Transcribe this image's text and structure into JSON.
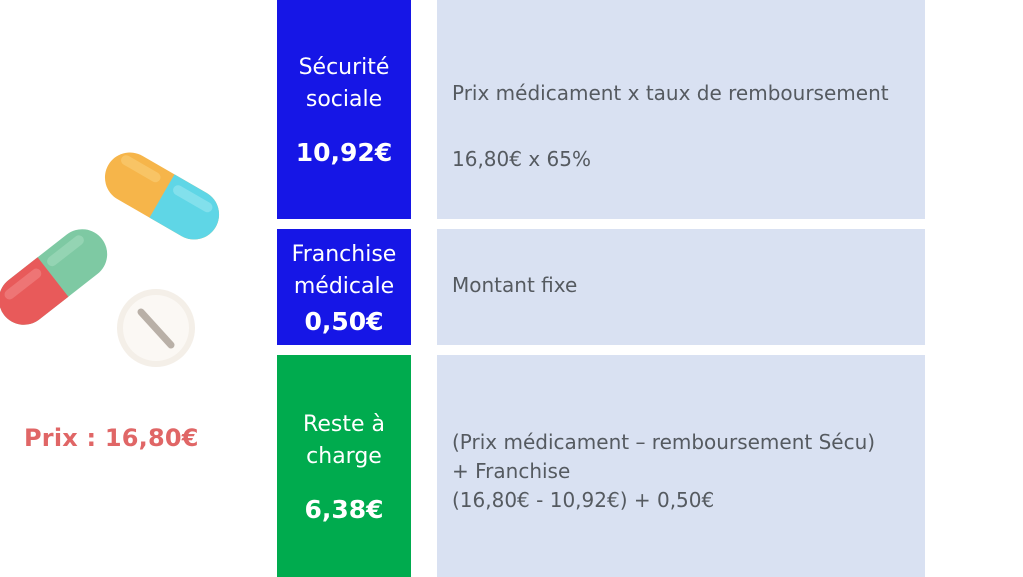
{
  "price_label": "Prix : 16,80€",
  "rows": [
    {
      "left_label_lines": [
        "Sécurité",
        "sociale"
      ],
      "left_amount": "10,92€",
      "right_lines": [
        "Prix médicament x taux de remboursement",
        "16,80€ x 65%"
      ]
    },
    {
      "left_label_lines": [
        "Franchise",
        "médicale"
      ],
      "left_amount": "0,50€",
      "right_lines": [
        "Montant fixe"
      ]
    },
    {
      "left_label_lines": [
        "Reste à",
        "charge"
      ],
      "left_amount": "6,38€",
      "right_lines": [
        "(Prix médicament – remboursement Sécu)",
        "+ Franchise",
        "(16,80€ - 10,92€) + 0,50€"
      ]
    }
  ],
  "colors": {
    "blue_box": "#1616e6",
    "green_box": "#00ab4e",
    "right_box_bg": "#d9e1f2",
    "price_text": "#e06666"
  },
  "icons": [
    "pill-capsule-icon",
    "pill-capsule-icon",
    "pill-tablet-icon"
  ]
}
